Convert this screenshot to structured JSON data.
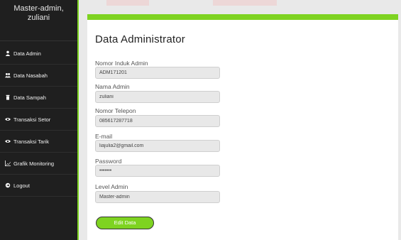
{
  "sidebar": {
    "user_line1": "Master-admin,",
    "user_line2": "zuliani",
    "items": [
      {
        "label": "Data Admin",
        "icon": "user-icon"
      },
      {
        "label": "Data Nasabah",
        "icon": "users-icon"
      },
      {
        "label": "Data Sampah",
        "icon": "trash-icon"
      },
      {
        "label": "Transaksi Setor",
        "icon": "eye-icon"
      },
      {
        "label": "Transaksi Tarik",
        "icon": "eye-icon"
      },
      {
        "label": "Grafik Monitoring",
        "icon": "chart-icon"
      },
      {
        "label": "Logout",
        "icon": "logout-icon"
      }
    ]
  },
  "main": {
    "title": "Data Administrator",
    "fields": [
      {
        "label": "Nomor Induk Admin",
        "value": "ADM171201"
      },
      {
        "label": "Nama Admin",
        "value": "zuliani"
      },
      {
        "label": "Nomor Telepon",
        "value": "085617287718"
      },
      {
        "label": "E-mail",
        "value": "liajulia2@gmail.com"
      },
      {
        "label": "Password",
        "value": "•••••••"
      },
      {
        "label": "Level Admin",
        "value": "Master-admin"
      }
    ],
    "edit_button": "Edit Data"
  },
  "colors": {
    "accent": "#7ed321",
    "sidebar_bg": "#1f1f1f"
  }
}
